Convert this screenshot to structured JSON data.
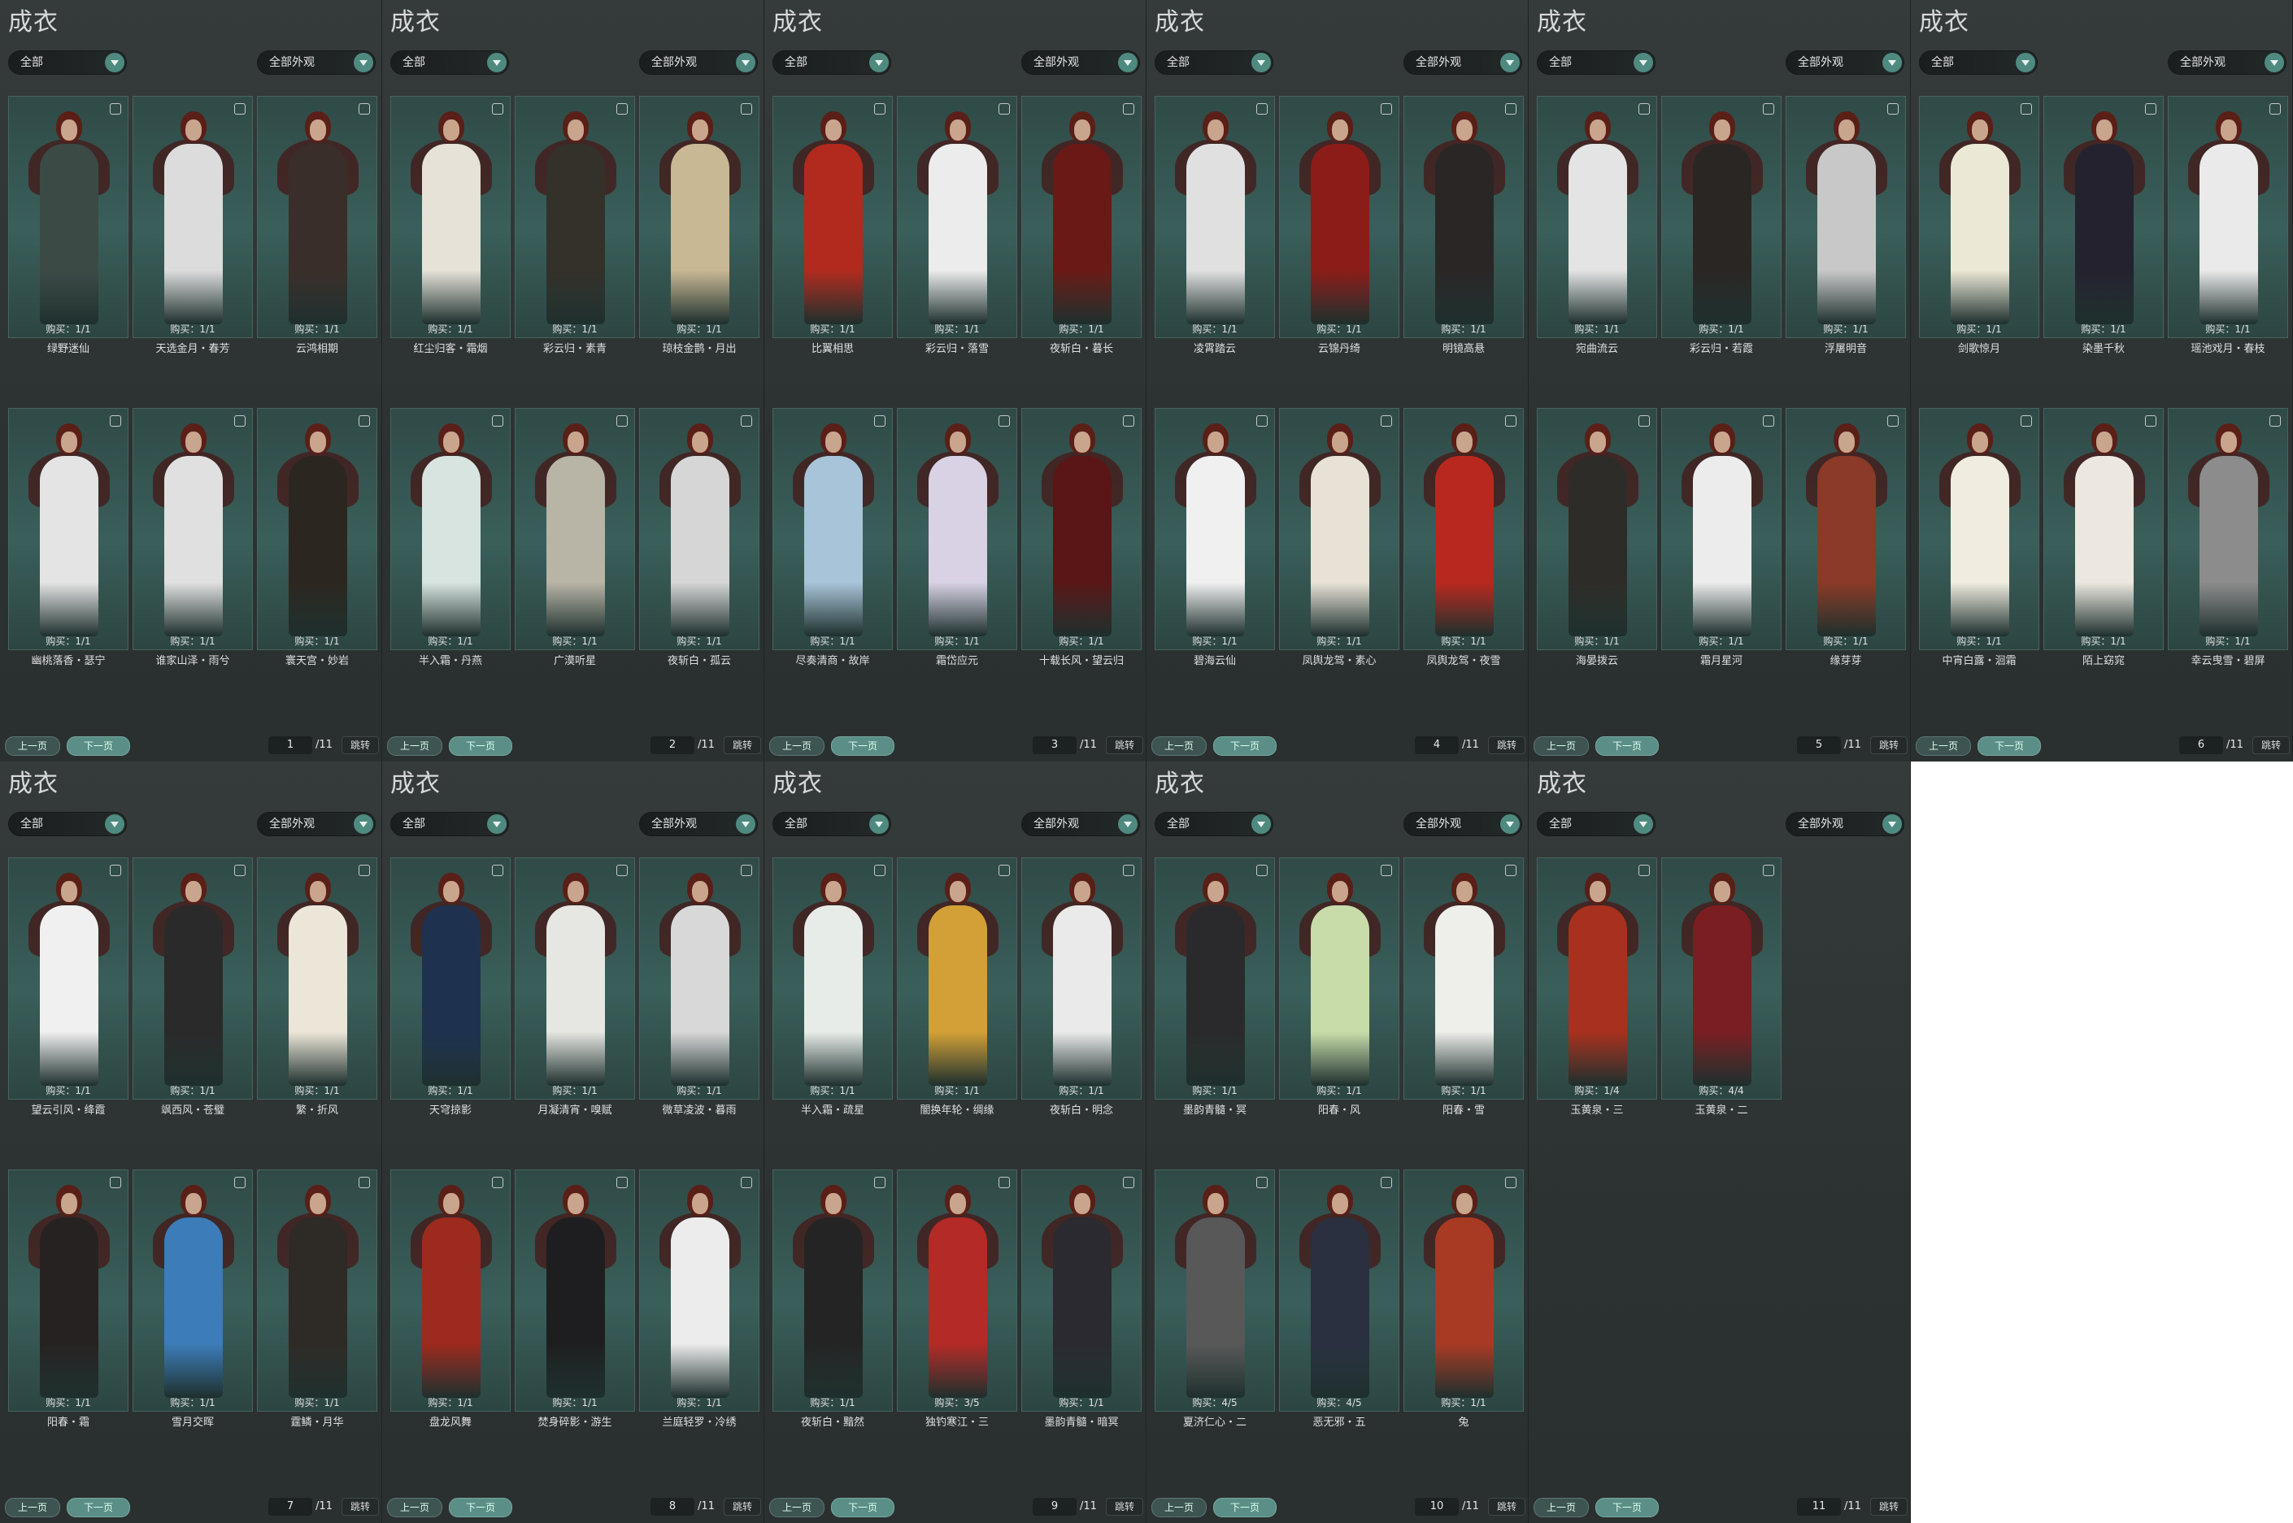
{
  "screenshot": "wardrobe-outfit-collage",
  "panels": [
    {
      "title": "成衣",
      "filter_a": "全部",
      "filter_b": "全部外观",
      "prev": "上一页",
      "next": "下一页",
      "page": "1",
      "total": "/11",
      "jump": "跳转",
      "cards": [
        {
          "name": "绿野迷仙",
          "buy": "购买：1/1",
          "color": "#3c4a46"
        },
        {
          "name": "天选金月・春芳",
          "buy": "购买：1/1",
          "color": "#dcdcdc"
        },
        {
          "name": "云鸿相期",
          "buy": "购买：1/1",
          "color": "#3a2e2a"
        },
        {
          "name": "幽桃落香・瑟宁",
          "buy": "购买：1/1",
          "color": "#e4e4e4"
        },
        {
          "name": "谁家山泽・雨兮",
          "buy": "购买：1/1",
          "color": "#e0e0e0"
        },
        {
          "name": "寰天宫・妙岩",
          "buy": "购买：1/1",
          "color": "#2c2620"
        }
      ]
    },
    {
      "title": "成衣",
      "filter_a": "全部",
      "filter_b": "全部外观",
      "prev": "上一页",
      "next": "下一页",
      "page": "2",
      "total": "/11",
      "jump": "跳转",
      "cards": [
        {
          "name": "红尘归客・霜烟",
          "buy": "购买：1/1",
          "color": "#e6e2d8"
        },
        {
          "name": "彩云归・素青",
          "buy": "购买：1/1",
          "color": "#34302a"
        },
        {
          "name": "琼枝金鹊・月出",
          "buy": "购买：1/1",
          "color": "#c8b894"
        },
        {
          "name": "半入霜・丹燕",
          "buy": "购买：1/1",
          "color": "#d8e4e0"
        },
        {
          "name": "广漠听星",
          "buy": "购买：1/1",
          "color": "#b8b4a6"
        },
        {
          "name": "夜斩白・孤云",
          "buy": "购买：1/1",
          "color": "#d6d6d6"
        }
      ]
    },
    {
      "title": "成衣",
      "filter_a": "全部",
      "filter_b": "全部外观",
      "prev": "上一页",
      "next": "下一页",
      "page": "3",
      "total": "/11",
      "jump": "跳转",
      "cards": [
        {
          "name": "比翼相思",
          "buy": "购买：1/1",
          "color": "#b22a1e"
        },
        {
          "name": "彩云归・落雪",
          "buy": "购买：1/1",
          "color": "#ececec"
        },
        {
          "name": "夜斩白・暮长",
          "buy": "购买：1/1",
          "color": "#6a1a16"
        },
        {
          "name": "尽奏清商・故岸",
          "buy": "购买：1/1",
          "color": "#a8c4d8"
        },
        {
          "name": "霜岱应元",
          "buy": "购买：1/1",
          "color": "#d8d2e4"
        },
        {
          "name": "十载长风・望云归",
          "buy": "购买：1/1",
          "color": "#5a1616"
        }
      ]
    },
    {
      "title": "成衣",
      "filter_a": "全部",
      "filter_b": "全部外观",
      "prev": "上一页",
      "next": "下一页",
      "page": "4",
      "total": "/11",
      "jump": "跳转",
      "cards": [
        {
          "name": "凌霄踏云",
          "buy": "购买：1/1",
          "color": "#e0e0e0"
        },
        {
          "name": "云锦丹绮",
          "buy": "购买：1/1",
          "color": "#8c1c18"
        },
        {
          "name": "明镜高悬",
          "buy": "购买：1/1",
          "color": "#2a2626"
        },
        {
          "name": "碧海云仙",
          "buy": "购买：1/1",
          "color": "#f0f0f0"
        },
        {
          "name": "凤舆龙驾・素心",
          "buy": "购买：1/1",
          "color": "#e8e2d6"
        },
        {
          "name": "凤舆龙驾・夜雪",
          "buy": "购买：1/1",
          "color": "#b8281e"
        }
      ]
    },
    {
      "title": "成衣",
      "filter_a": "全部",
      "filter_b": "全部外观",
      "prev": "上一页",
      "next": "下一页",
      "page": "5",
      "total": "/11",
      "jump": "跳转",
      "cards": [
        {
          "name": "宛曲流云",
          "buy": "购买：1/1",
          "color": "#e4e4e4"
        },
        {
          "name": "彩云归・若霞",
          "buy": "购买：1/1",
          "color": "#2a2624"
        },
        {
          "name": "浮屠明音",
          "buy": "购买：1/1",
          "color": "#c8c8c8"
        },
        {
          "name": "海晏拨云",
          "buy": "购买：1/1",
          "color": "#2e2c28"
        },
        {
          "name": "霜月星河",
          "buy": "购买：1/1",
          "color": "#ececec"
        },
        {
          "name": "缘芽芽",
          "buy": "购买：1/1",
          "color": "#8a3a26"
        }
      ]
    },
    {
      "title": "成衣",
      "filter_a": "全部",
      "filter_b": "全部外观",
      "prev": "上一页",
      "next": "下一页",
      "page": "6",
      "total": "/11",
      "jump": "跳转",
      "cards": [
        {
          "name": "剑歌惊月",
          "buy": "购买：1/1",
          "color": "#ece8d6"
        },
        {
          "name": "染墨千秋",
          "buy": "购买：1/1",
          "color": "#24222e"
        },
        {
          "name": "瑶池戏月・春枝",
          "buy": "购买：1/1",
          "color": "#eaeaea"
        },
        {
          "name": "中宵白露・洄霜",
          "buy": "购买：1/1",
          "color": "#f0ece0"
        },
        {
          "name": "陌上窈窕",
          "buy": "购买：1/1",
          "color": "#ece8e0"
        },
        {
          "name": "幸云曳雪・碧屏",
          "buy": "购买：1/1",
          "color": "#8c8c8c"
        }
      ]
    },
    {
      "title": "成衣",
      "filter_a": "全部",
      "filter_b": "全部外观",
      "prev": "上一页",
      "next": "下一页",
      "page": "7",
      "total": "/11",
      "jump": "跳转",
      "cards": [
        {
          "name": "望云引风・绛霞",
          "buy": "购买：1/1",
          "color": "#f0f0f0"
        },
        {
          "name": "飒西风・苍璧",
          "buy": "购买：1/1",
          "color": "#2a2a2a"
        },
        {
          "name": "繁・折风",
          "buy": "购买：1/1",
          "color": "#ece6d8"
        },
        {
          "name": "阳春・霜",
          "buy": "购买：1/1",
          "color": "#262222"
        },
        {
          "name": "雪月交晖",
          "buy": "购买：1/1",
          "color": "#3c7cb8"
        },
        {
          "name": "霆鳞・月华",
          "buy": "购买：1/1",
          "color": "#2e2a26"
        }
      ]
    },
    {
      "title": "成衣",
      "filter_a": "全部",
      "filter_b": "全部外观",
      "prev": "上一页",
      "next": "下一页",
      "page": "8",
      "total": "/11",
      "jump": "跳转",
      "cards": [
        {
          "name": "天穹掠影",
          "buy": "购买：1/1",
          "color": "#1e3250"
        },
        {
          "name": "月凝清宵・嗅赋",
          "buy": "购买：1/1",
          "color": "#e6e6e2"
        },
        {
          "name": "微草凌波・暮雨",
          "buy": "购买：1/1",
          "color": "#d8d8d8"
        },
        {
          "name": "盘龙风舞",
          "buy": "购买：1/1",
          "color": "#9c2a1e"
        },
        {
          "name": "焚身碎影・游生",
          "buy": "购买：1/1",
          "color": "#1e1e20"
        },
        {
          "name": "兰庭轻罗・冷绣",
          "buy": "购买：1/1",
          "color": "#ececec"
        }
      ]
    },
    {
      "title": "成衣",
      "filter_a": "全部",
      "filter_b": "全部外观",
      "prev": "上一页",
      "next": "下一页",
      "page": "9",
      "total": "/11",
      "jump": "跳转",
      "cards": [
        {
          "name": "半入霜・疏星",
          "buy": "购买：1/1",
          "color": "#e8ece8"
        },
        {
          "name": "闇换年轮・绸缘",
          "buy": "购买：1/1",
          "color": "#d2a036"
        },
        {
          "name": "夜斩白・明念",
          "buy": "购买：1/1",
          "color": "#eaeaea"
        },
        {
          "name": "夜斩白・黯然",
          "buy": "购买：1/1",
          "color": "#242424"
        },
        {
          "name": "独钓寒江・三",
          "buy": "购买：3/5",
          "color": "#b42a26"
        },
        {
          "name": "墨韵青髓・暗冥",
          "buy": "购买：1/1",
          "color": "#2a2a30"
        }
      ]
    },
    {
      "title": "成衣",
      "filter_a": "全部",
      "filter_b": "全部外观",
      "prev": "上一页",
      "next": "下一页",
      "page": "10",
      "total": "/11",
      "jump": "跳转",
      "cards": [
        {
          "name": "墨韵青髓・冥",
          "buy": "购买：1/1",
          "color": "#2a2a2c"
        },
        {
          "name": "阳春・风",
          "buy": "购买：1/1",
          "color": "#c8dcaa"
        },
        {
          "name": "阳春・雪",
          "buy": "购买：1/1",
          "color": "#eeeeea"
        },
        {
          "name": "夏济仁心・二",
          "buy": "购买：4/5",
          "color": "#585858"
        },
        {
          "name": "恶无邪・五",
          "buy": "购买：4/5",
          "color": "#2a3040"
        },
        {
          "name": "兔",
          "buy": "购买：1/1",
          "color": "#a83a24"
        }
      ]
    },
    {
      "title": "成衣",
      "filter_a": "全部",
      "filter_b": "全部外观",
      "prev": "上一页",
      "next": "下一页",
      "page": "11",
      "total": "/11",
      "jump": "跳转",
      "cards": [
        {
          "name": "玉黄泉・三",
          "buy": "购买：1/4",
          "color": "#a8301e"
        },
        {
          "name": "玉黄泉・二",
          "buy": "购买：4/4",
          "color": "#7a1e22"
        }
      ]
    }
  ]
}
